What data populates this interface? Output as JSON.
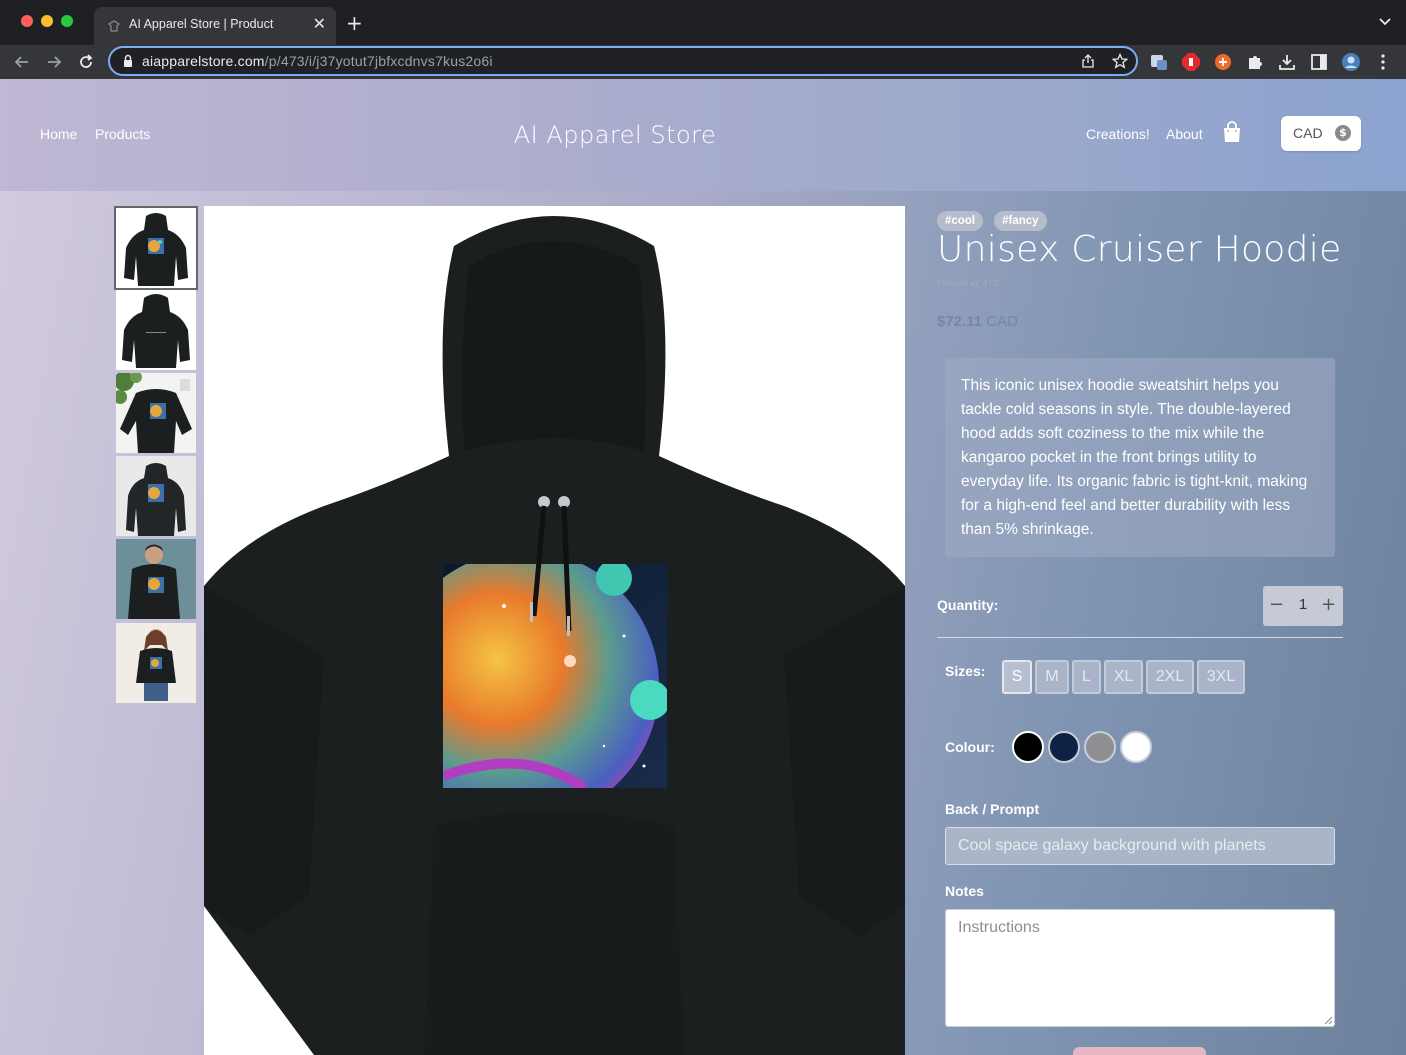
{
  "browser": {
    "tab_title": "AI Apparel Store | Product",
    "url_host": "aiapparelstore.com",
    "url_path": "/p/473/i/j37yotut7jbfxcdnvs7kus2o6i"
  },
  "header": {
    "nav_home": "Home",
    "nav_products": "Products",
    "brand": "AI Apparel Store",
    "nav_creations": "Creations!",
    "nav_about": "About",
    "currency": "CAD",
    "currency_icon": "$"
  },
  "product": {
    "tags": [
      "#cool",
      "#fancy"
    ],
    "title": "Unisex Cruiser Hoodie",
    "product_id": "Product id: 473",
    "price_amount": "$72.11",
    "price_currency": "CAD",
    "description": "This iconic unisex hoodie sweatshirt helps you tackle cold seasons in style. The double-layered hood adds soft coziness to the mix while the kangaroo pocket in the front brings utility to everyday life. Its organic fabric is tight-knit, making for a high-end feel and better durability with less than 5% shrinkage.",
    "quantity_label": "Quantity:",
    "quantity": "1",
    "quantity_minus": "−",
    "quantity_plus": "+",
    "sizes_label": "Sizes:",
    "sizes": [
      "S",
      "M",
      "L",
      "XL",
      "2XL",
      "3XL"
    ],
    "selected_size": "S",
    "colour_label": "Colour:",
    "colours": [
      "#000000",
      "#0d2244",
      "#8f8f93",
      "#ffffff"
    ],
    "selected_colour": "#000000",
    "prompt_label": "Back / Prompt",
    "prompt_value": "Cool space galaxy background with planets",
    "notes_label": "Notes",
    "notes_placeholder": "Instructions"
  },
  "thumbnails": [
    "hoodie-front",
    "hoodie-back",
    "hoodie-flatlay",
    "hoodie-hanger",
    "hoodie-model-man",
    "hoodie-model-woman"
  ]
}
